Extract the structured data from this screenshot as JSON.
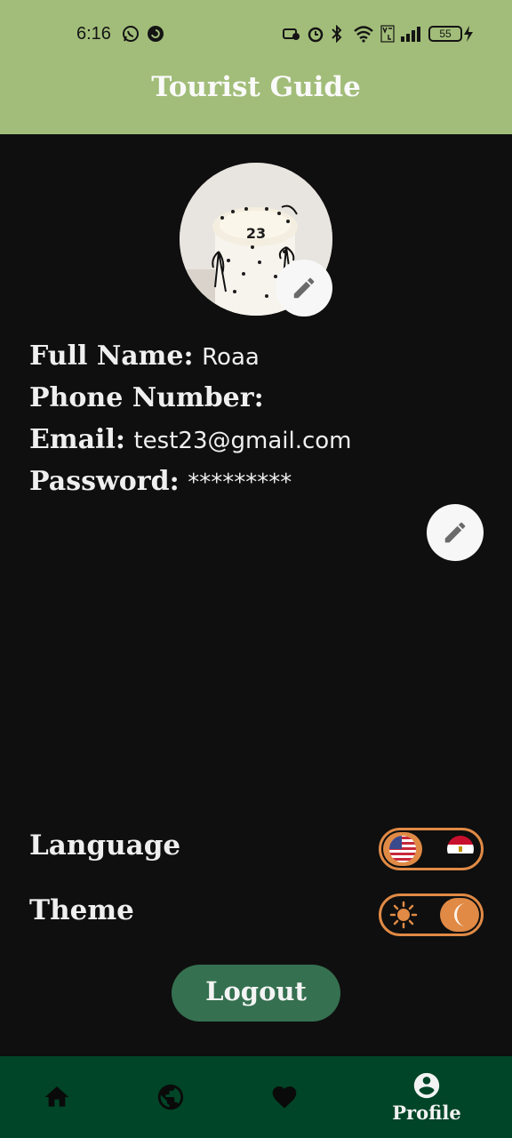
{
  "status_bar": {
    "time": "6:16",
    "battery": "55"
  },
  "app_bar": {
    "title": "Tourist Guide"
  },
  "avatar": {
    "cake_text": "23"
  },
  "profile": {
    "fields": [
      {
        "label": "Full Name:",
        "value": "Roaa"
      },
      {
        "label": "Phone Number:",
        "value": ""
      },
      {
        "label": "Email:",
        "value": "test23@gmail.com"
      },
      {
        "label": "Password:",
        "value": "*********"
      }
    ]
  },
  "settings": {
    "language_label": "Language",
    "language_selected": "english",
    "theme_label": "Theme",
    "theme_selected": "dark"
  },
  "logout_label": "Logout",
  "bottom_nav": {
    "items": [
      {
        "name": "home-icon"
      },
      {
        "name": "globe-icon"
      },
      {
        "name": "heart-icon"
      },
      {
        "name": "profile-icon",
        "label": "Profile",
        "active": true
      }
    ]
  },
  "colors": {
    "app_bar": "#a2bd79",
    "background": "#0f0f0f",
    "accent_orange": "#e08a45",
    "logout_button": "#357050",
    "bottom_nav": "#004527"
  }
}
